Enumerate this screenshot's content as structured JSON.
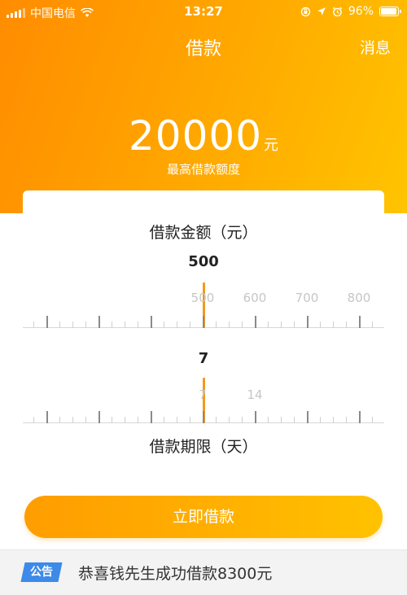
{
  "status_bar": {
    "carrier": "中国电信",
    "time": "13:27",
    "battery": "96%",
    "battery_level": 0.96
  },
  "nav": {
    "title": "借款",
    "message_label": "消息"
  },
  "credit": {
    "amount": "20000",
    "unit": "元",
    "label": "最高借款额度"
  },
  "amount_slider": {
    "title": "借款金额（元）",
    "value": "500",
    "tick_labels": [
      "500",
      "600",
      "700",
      "800"
    ]
  },
  "term_slider": {
    "value": "7",
    "tick_labels": [
      "7",
      "14"
    ],
    "title": "借款期限（天）"
  },
  "cta": {
    "label": "立即借款"
  },
  "notice": {
    "badge": "公告",
    "text": "恭喜钱先生成功借款8300元"
  },
  "colors": {
    "accent": "#ff9d00",
    "indicator": "#f39a1a",
    "badge": "#3d8ae8"
  }
}
